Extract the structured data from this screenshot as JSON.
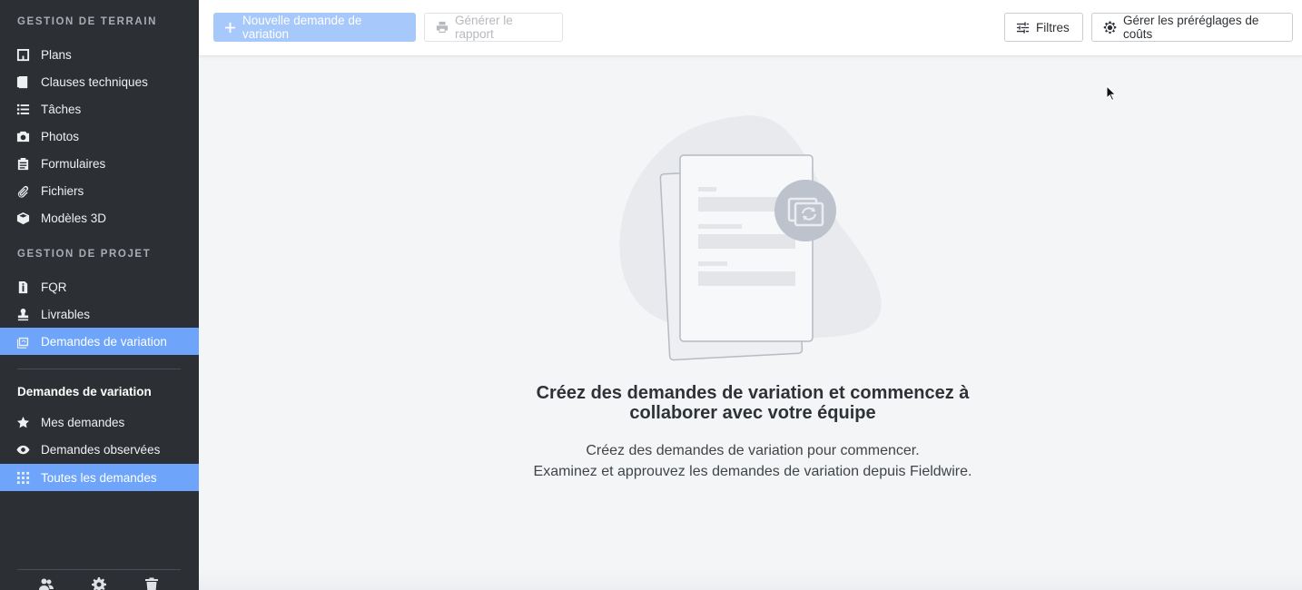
{
  "sidebar": {
    "field_section": "GESTION DE TERRAIN",
    "field_items": [
      {
        "label": "Plans",
        "icon": "plans-icon"
      },
      {
        "label": "Clauses techniques",
        "icon": "specs-icon"
      },
      {
        "label": "Tâches",
        "icon": "list-icon"
      },
      {
        "label": "Photos",
        "icon": "camera-icon"
      },
      {
        "label": "Formulaires",
        "icon": "clipboard-icon"
      },
      {
        "label": "Fichiers",
        "icon": "paperclip-icon"
      },
      {
        "label": "Modèles 3D",
        "icon": "cube-icon"
      }
    ],
    "project_section": "GESTION DE PROJET",
    "project_items": [
      {
        "label": "FQR",
        "icon": "info-doc-icon"
      },
      {
        "label": "Livrables",
        "icon": "stamp-icon"
      },
      {
        "label": "Demandes de variation",
        "icon": "change-order-icon",
        "active": true
      }
    ],
    "sub_title": "Demandes de variation",
    "sub_items": [
      {
        "label": "Mes demandes",
        "icon": "star-icon"
      },
      {
        "label": "Demandes observées",
        "icon": "eye-icon"
      },
      {
        "label": "Toutes les demandes",
        "icon": "grid-icon",
        "active": true
      }
    ],
    "bottom_icons": [
      "users-icon",
      "gear-icon",
      "trash-icon"
    ]
  },
  "toolbar": {
    "new_label": "Nouvelle demande de variation",
    "report_label": "Générer le rapport",
    "filters_label": "Filtres",
    "presets_label": "Gérer les préréglages de coûts"
  },
  "empty_state": {
    "title_line1": "Créez des demandes de variation et commencez à",
    "title_line2": "collaborer avec votre équipe",
    "desc_line1": "Créez des demandes de variation pour commencer.",
    "desc_line2": "Examinez et approuvez les demandes de variation depuis Fieldwire."
  },
  "colors": {
    "sidebar_bg": "#2c2f33",
    "active_bg": "#6ea5fb",
    "primary_disabled": "#a6c8fa",
    "content_bg": "#f4f5f7"
  }
}
